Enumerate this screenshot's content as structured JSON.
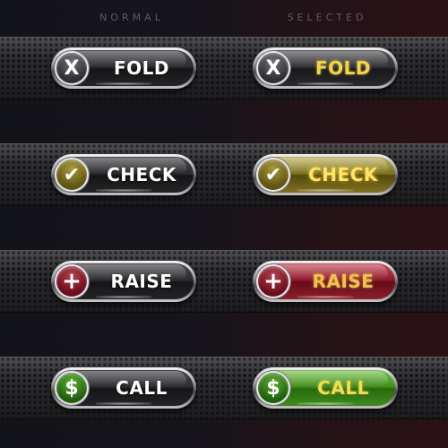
{
  "headers": {
    "normal": "NORMAL",
    "selected": "SELECTED"
  },
  "buttons": {
    "fold": {
      "label": "FOLD",
      "icon": "X",
      "icon_name": "close-icon"
    },
    "check": {
      "label": "CHECK",
      "icon": "✔",
      "icon_name": "checkmark-icon"
    },
    "raise": {
      "label": "RAISE",
      "icon": "+",
      "icon_name": "plus-icon"
    },
    "call": {
      "label": "CALL",
      "icon": "$",
      "icon_name": "dollar-icon"
    }
  },
  "colors": {
    "check_accent": "#7a6f1c",
    "raise_accent": "#8c1626",
    "call_accent": "#3d8a1a",
    "selected_text": "#f4d449",
    "normal_text": "#ffffff"
  }
}
